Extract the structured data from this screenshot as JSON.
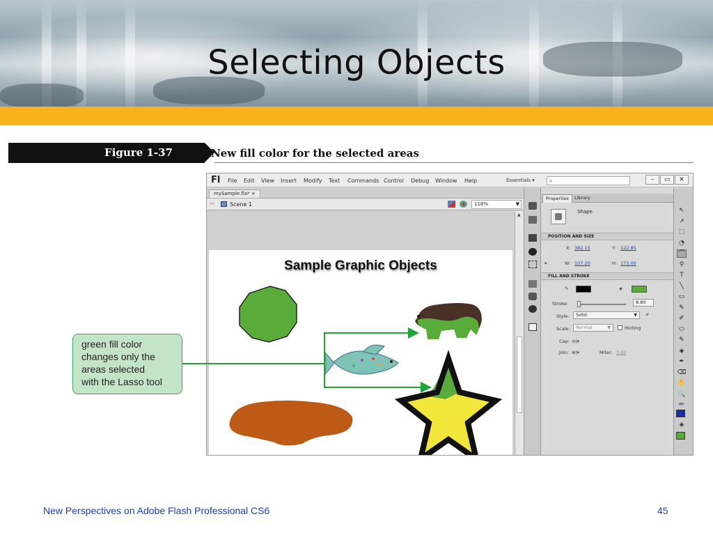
{
  "slide": {
    "title": "Selecting Objects",
    "footer": "New Perspectives on Adobe Flash Professional CS6",
    "page_number": "45"
  },
  "figure": {
    "label": "Figure 1-37",
    "caption": "New fill color for the selected areas"
  },
  "callout": {
    "lines": [
      "green fill color",
      "changes only the",
      "areas selected",
      "with the Lasso tool"
    ]
  },
  "flash": {
    "logo": "Fl",
    "menu": [
      "File",
      "Edit",
      "View",
      "Insert",
      "Modify",
      "Text",
      "Commands",
      "Control",
      "Debug",
      "Window",
      "Help"
    ],
    "workspace": "Essentials ▾",
    "search_placeholder": "⌕",
    "window_buttons": [
      "–",
      "▭",
      "✕"
    ],
    "doc_tab": "mySample.fla* ×",
    "scene": "Scene 1",
    "zoom": "118%",
    "stage_title": "Sample Graphic Objects",
    "shape_colors": {
      "octagon": "#5aac3a",
      "bear_body": "#4a3128",
      "bear_fill": "#5aac3a",
      "fish": "#7fc3b6",
      "star_fill": "#f2e63a",
      "star_selected": "#5aac3a",
      "blob": "#bd5a16",
      "accent_green": "#22a33a"
    },
    "properties": {
      "tabs": [
        "Properties",
        "Library"
      ],
      "object_type": "Shape",
      "section_position": "POSITION AND SIZE",
      "x_label": "X:",
      "x_value": "382.15",
      "y_label": "Y:",
      "y_value": "122.85",
      "w_label": "W:",
      "w_value": "107.20",
      "h_label": "H:",
      "h_value": "173.00",
      "section_fill": "FILL AND STROKE",
      "stroke_color": "#000000",
      "fill_color": "#5aac3a",
      "stroke_label": "Stroke:",
      "stroke_value": "8.80",
      "style_label": "Style:",
      "style_value": "Solid",
      "scale_label": "Scale:",
      "scale_value": "Normal",
      "hinting_label": "Hinting",
      "cap_label": "Cap:",
      "join_label": "Join:",
      "miter_label": "Miter:",
      "miter_value": "3.00"
    },
    "tools": [
      "↖",
      "↗",
      "⬚",
      "◔",
      "⌒",
      "⚲",
      "T",
      "╲",
      "▭",
      "✎",
      "✐",
      "⬭",
      "✎",
      "◈",
      "✒",
      "⌫",
      "✋",
      "🔍",
      "✏"
    ],
    "tool_colors": {
      "stroke": "#1f2f9a",
      "fill": "#5aac3a"
    }
  }
}
